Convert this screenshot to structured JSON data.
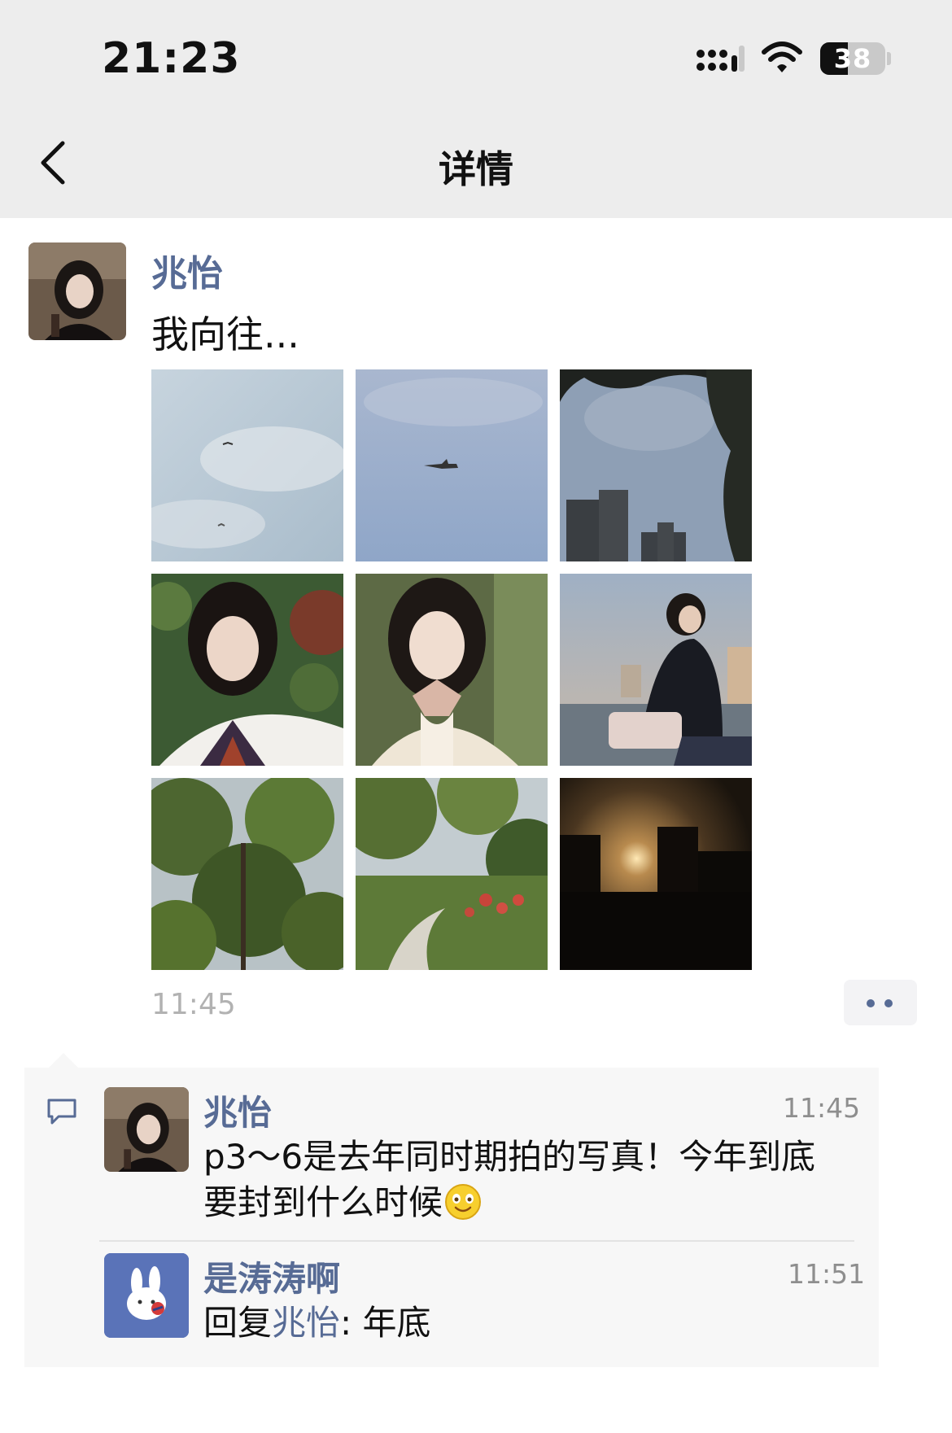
{
  "status_bar": {
    "time": "21:23",
    "battery_level": "38",
    "icons": [
      "cellular-signal-icon",
      "wifi-icon",
      "battery-icon"
    ]
  },
  "nav": {
    "back_icon": "chevron-left-icon",
    "title": "详情"
  },
  "post": {
    "author": "兆怡",
    "text": "我向往...",
    "time": "11:45",
    "photos": [
      "sky with birds",
      "sky with airplane",
      "trees and buildings",
      "girl in sailor uniform",
      "girl in cream cardigan",
      "girl by the water",
      "green trees",
      "garden path",
      "sunset silhouette"
    ],
    "more_icon": "more-dots-icon"
  },
  "comments": [
    {
      "author": "兆怡",
      "time": "11:45",
      "text": "p3～6是去年同时期拍的写真！今年到底",
      "text_line2": "要封到什么时候",
      "emoji": "smiling-face-emoji"
    },
    {
      "author": "是涛涛啊",
      "time": "11:51",
      "reply_prefix": "回复",
      "reply_to": "兆怡",
      "text": ": 年底"
    }
  ],
  "colors": {
    "link_blue": "#576b95",
    "nav_bg": "#ededed",
    "comment_bg": "#f7f7f7",
    "timestamp": "#b2b2b2"
  }
}
